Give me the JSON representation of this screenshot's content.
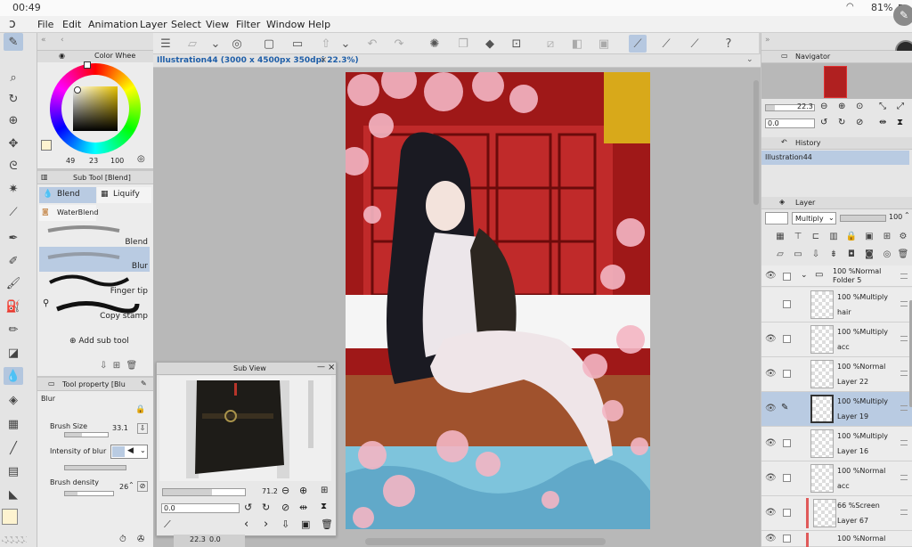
{
  "status": {
    "time": "00:49",
    "battery": "81%"
  },
  "menu": [
    "File",
    "Edit",
    "Animation",
    "Layer",
    "Select",
    "View",
    "Filter",
    "Window",
    "Help"
  ],
  "color_panel": {
    "title": "Color Whee",
    "values": [
      "49",
      "23",
      "100"
    ]
  },
  "sub_tool": {
    "title": "Sub Tool [Blend]",
    "tabs": [
      "Blend",
      "Liquify",
      "WaterBlend"
    ],
    "brushes": [
      "Blend",
      "Blur",
      "Finger tip",
      "Copy stamp"
    ],
    "selected": "Blur",
    "add_label": "Add sub tool"
  },
  "tool_property": {
    "title": "Tool property [Blu",
    "name": "Blur",
    "brush_size_label": "Brush Size",
    "brush_size": "33.1",
    "intensity_label": "Intensity of blur",
    "density_label": "Brush density",
    "density": "26"
  },
  "document": {
    "tab": "Illustration44 (3000 x 4500px 350dpi 22.3%)"
  },
  "sub_view": {
    "title": "Sub View",
    "zoom": "71.2",
    "rotation": "0.0"
  },
  "bottom_status": {
    "zoom": "22.3",
    "rotation": "0.0"
  },
  "navigator": {
    "title": "Navigator",
    "zoom": "22.3",
    "rotation": "0.0"
  },
  "history": {
    "title": "History",
    "items": [
      "Illustration44"
    ]
  },
  "layer_panel": {
    "title": "Layer",
    "blend_mode": "Multiply",
    "opacity": "100",
    "folder": {
      "mode": "100 %Normal",
      "name": "Folder 5"
    },
    "layers": [
      {
        "mode": "100 %Multiply",
        "name": "hair"
      },
      {
        "mode": "100 %Multiply",
        "name": "acc"
      },
      {
        "mode": "100 %Normal",
        "name": "Layer 22"
      },
      {
        "mode": "100 %Multiply",
        "name": "Layer 19",
        "selected": true
      },
      {
        "mode": "100 %Multiply",
        "name": "Layer 16"
      },
      {
        "mode": "100 %Normal",
        "name": "acc"
      },
      {
        "mode": "66 %Screen",
        "name": "Layer 67"
      },
      {
        "mode": "100 %Normal",
        "name": ""
      }
    ]
  },
  "colors": {
    "accent": "#b9cbe2",
    "main_color": "#fdf3d0",
    "sub_color": "#14a01e"
  }
}
